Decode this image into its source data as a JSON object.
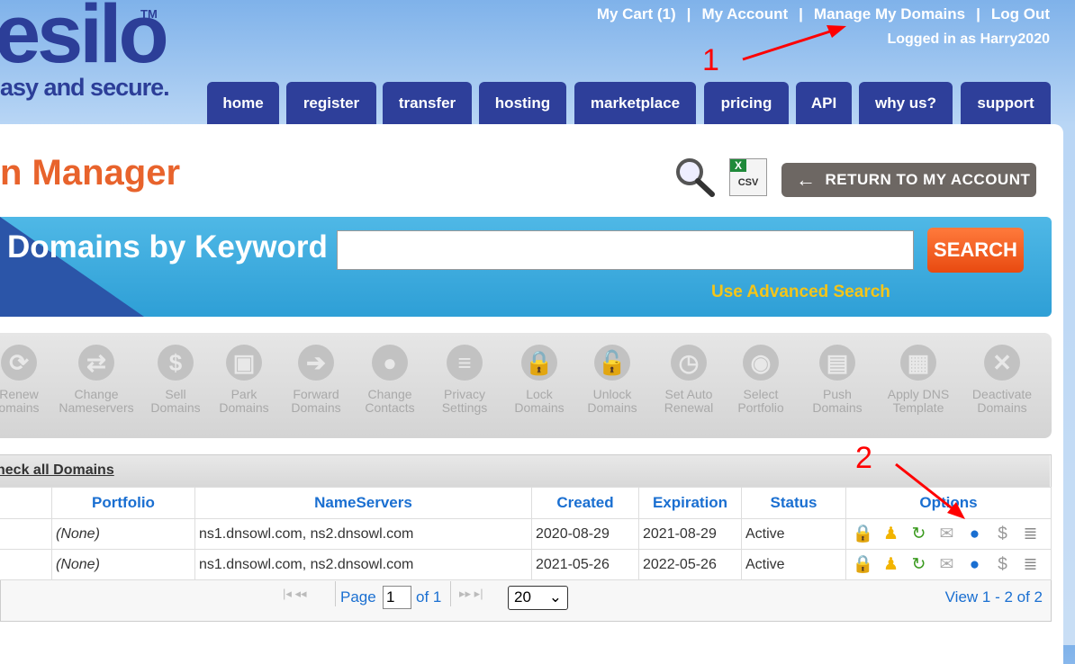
{
  "logo": {
    "text": "esilo",
    "tm": "TM",
    "tagline": "asy and secure."
  },
  "top_links": [
    {
      "label": "My Cart (1)"
    },
    {
      "label": "My Account"
    },
    {
      "label": "Manage My Domains"
    },
    {
      "label": "Log Out"
    }
  ],
  "separator": "|",
  "logged_in": "Logged in as Harry2020",
  "nav": [
    "home",
    "register",
    "transfer",
    "hosting",
    "marketplace",
    "pricing",
    "API",
    "why us?",
    "support"
  ],
  "page_title": "n Manager",
  "csv_label": "CSV",
  "return_button": "RETURN TO MY ACCOUNT",
  "search": {
    "heading": "Domains by Keyword",
    "value": "",
    "button": "SEARCH",
    "advanced": "Use Advanced Search"
  },
  "toolbar": [
    {
      "label": "Renew\nomains",
      "icon": "renew-icon",
      "glyph": "⟳"
    },
    {
      "label": "Change\nNameservers",
      "icon": "arrows-icon",
      "glyph": "⇄"
    },
    {
      "label": "Sell\nDomains",
      "icon": "dollar-icon",
      "glyph": "$"
    },
    {
      "label": "Park\nDomains",
      "icon": "bus-icon",
      "glyph": "▣"
    },
    {
      "label": "Forward\nDomains",
      "icon": "arrow-right-icon",
      "glyph": "➔"
    },
    {
      "label": "Change\nContacts",
      "icon": "contacts-icon",
      "glyph": "●"
    },
    {
      "label": "Privacy\nSettings",
      "icon": "tag-icon",
      "glyph": "≡"
    },
    {
      "label": "Lock\nDomains",
      "icon": "lock-icon",
      "glyph": "🔒"
    },
    {
      "label": "Unlock\nDomains",
      "icon": "unlock-icon",
      "glyph": "🔓"
    },
    {
      "label": "Set Auto\nRenewal",
      "icon": "clock-icon",
      "glyph": "◷"
    },
    {
      "label": "Select\nPortfolio",
      "icon": "disc-icon",
      "glyph": "◉"
    },
    {
      "label": "Push\nDomains",
      "icon": "monitors-icon",
      "glyph": "▤"
    },
    {
      "label": "Apply DNS\nTemplate",
      "icon": "template-icon",
      "glyph": "▦"
    },
    {
      "label": "Deactivate\nDomains",
      "icon": "close-icon",
      "glyph": "✕"
    }
  ],
  "table": {
    "check_all": "heck all Domains",
    "columns": [
      "",
      "Portfolio",
      "NameServers",
      "Created",
      "Expiration",
      "Status",
      "Options"
    ],
    "rows": [
      {
        "portfolio": "(None)",
        "nameservers": "ns1.dnsowl.com, ns2.dnsowl.com",
        "created": "2020-08-29",
        "expiration": "2021-08-29",
        "status": "Active"
      },
      {
        "portfolio": "(None)",
        "nameservers": "ns1.dnsowl.com, ns2.dnsowl.com",
        "created": "2021-05-26",
        "expiration": "2022-05-26",
        "status": "Active"
      }
    ],
    "option_icons": [
      "lock-icon",
      "contact-icon",
      "renew-icon",
      "email-icon",
      "dns-globe-icon",
      "dollar-icon",
      "database-icon"
    ]
  },
  "pager": {
    "page_label": "Page",
    "page": "1",
    "of": "of 1",
    "per_page": "20",
    "view": "View 1 - 2 of 2"
  },
  "annotations": [
    "1",
    "2"
  ],
  "colors": {
    "nav": "#2e3f9a",
    "title": "#e8632c",
    "link": "#1a6fd1",
    "search_button": "#f05a1c",
    "advanced": "#f5c518",
    "annotation": "#ff0000"
  }
}
